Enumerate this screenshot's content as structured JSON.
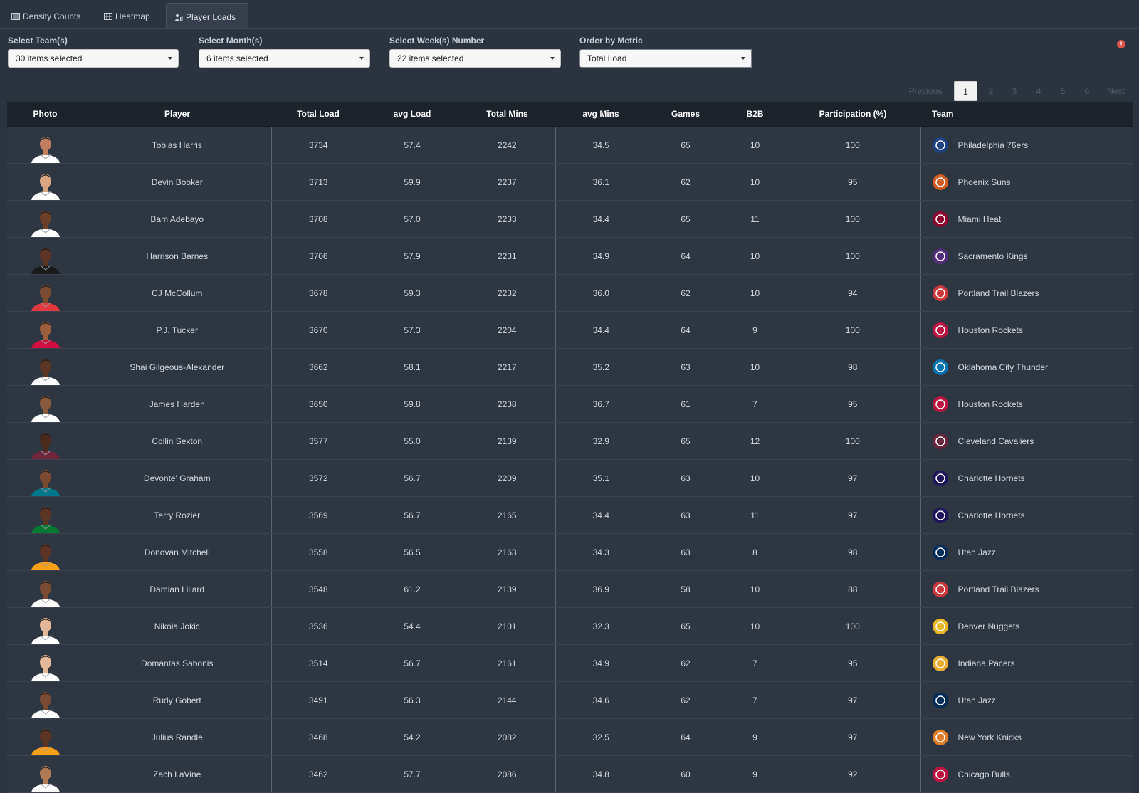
{
  "tabs": [
    {
      "label": "Density Counts",
      "icon": "list-icon"
    },
    {
      "label": "Heatmap",
      "icon": "grid-icon"
    },
    {
      "label": "Player Loads",
      "icon": "user-chart-icon",
      "active": true
    }
  ],
  "filters": {
    "teams": {
      "label": "Select Team(s)",
      "value": "30 items selected"
    },
    "months": {
      "label": "Select Month(s)",
      "value": "6 items selected"
    },
    "weeks": {
      "label": "Select Week(s) Number",
      "value": "22 items selected"
    },
    "metric": {
      "label": "Order by Metric",
      "value": "Total Load"
    }
  },
  "error_icon": {
    "glyph": "!",
    "color": "#d9534f"
  },
  "pagination": {
    "previous": "Previous",
    "next": "Next",
    "pages": [
      "1",
      "2",
      "3",
      "4",
      "5",
      "6"
    ],
    "current": "1"
  },
  "table": {
    "columns": [
      "Photo",
      "Player",
      "Total Load",
      "avg Load",
      "Total Mins",
      "avg Mins",
      "Games",
      "B2B",
      "Participation (%)",
      "Team"
    ],
    "rows": [
      {
        "player": "Tobias Harris",
        "total_load": "3734",
        "avg_load": "57.4",
        "total_mins": "2242",
        "avg_mins": "34.5",
        "games": "65",
        "b2b": "10",
        "participation": "100",
        "team": "Philadelphia 76ers",
        "skin": "#c08060",
        "jersey": "#ffffff",
        "logo_color": "#1d428a"
      },
      {
        "player": "Devin Booker",
        "total_load": "3713",
        "avg_load": "59.9",
        "total_mins": "2237",
        "avg_mins": "36.1",
        "games": "62",
        "b2b": "10",
        "participation": "95",
        "team": "Phoenix Suns",
        "skin": "#d9a583",
        "jersey": "#ffffff",
        "logo_color": "#e56020"
      },
      {
        "player": "Bam Adebayo",
        "total_load": "3708",
        "avg_load": "57.0",
        "total_mins": "2233",
        "avg_mins": "34.4",
        "games": "65",
        "b2b": "11",
        "participation": "100",
        "team": "Miami Heat",
        "skin": "#6b3f2a",
        "jersey": "#ffffff",
        "logo_color": "#98002e"
      },
      {
        "player": "Harrison Barnes",
        "total_load": "3706",
        "avg_load": "57.9",
        "total_mins": "2231",
        "avg_mins": "34.9",
        "games": "64",
        "b2b": "10",
        "participation": "100",
        "team": "Sacramento Kings",
        "skin": "#5a3424",
        "jersey": "#1a1a1a",
        "logo_color": "#5a2d81"
      },
      {
        "player": "CJ McCollum",
        "total_load": "3678",
        "avg_load": "59.3",
        "total_mins": "2232",
        "avg_mins": "36.0",
        "games": "62",
        "b2b": "10",
        "participation": "94",
        "team": "Portland Trail Blazers",
        "skin": "#7a4a33",
        "jersey": "#e03a3e",
        "logo_color": "#e03a3e"
      },
      {
        "player": "P.J. Tucker",
        "total_load": "3670",
        "avg_load": "57.3",
        "total_mins": "2204",
        "avg_mins": "34.4",
        "games": "64",
        "b2b": "9",
        "participation": "100",
        "team": "Houston Rockets",
        "skin": "#9a603e",
        "jersey": "#ce1141",
        "logo_color": "#ce1141"
      },
      {
        "player": "Shai Gilgeous-Alexander",
        "total_load": "3662",
        "avg_load": "58.1",
        "total_mins": "2217",
        "avg_mins": "35.2",
        "games": "63",
        "b2b": "10",
        "participation": "98",
        "team": "Oklahoma City Thunder",
        "skin": "#5a3424",
        "jersey": "#ffffff",
        "logo_color": "#007ac1"
      },
      {
        "player": "James Harden",
        "total_load": "3650",
        "avg_load": "59.8",
        "total_mins": "2238",
        "avg_mins": "36.7",
        "games": "61",
        "b2b": "7",
        "participation": "95",
        "team": "Houston Rockets",
        "skin": "#8a5a3c",
        "jersey": "#ffffff",
        "logo_color": "#ce1141"
      },
      {
        "player": "Collin Sexton",
        "total_load": "3577",
        "avg_load": "55.0",
        "total_mins": "2139",
        "avg_mins": "32.9",
        "games": "65",
        "b2b": "12",
        "participation": "100",
        "team": "Cleveland Cavaliers",
        "skin": "#4a2a1c",
        "jersey": "#6f263d",
        "logo_color": "#6f263d"
      },
      {
        "player": "Devonte' Graham",
        "total_load": "3572",
        "avg_load": "56.7",
        "total_mins": "2209",
        "avg_mins": "35.1",
        "games": "63",
        "b2b": "10",
        "participation": "97",
        "team": "Charlotte Hornets",
        "skin": "#7a4a33",
        "jersey": "#00788c",
        "logo_color": "#1d1160"
      },
      {
        "player": "Terry Rozier",
        "total_load": "3569",
        "avg_load": "56.7",
        "total_mins": "2165",
        "avg_mins": "34.4",
        "games": "63",
        "b2b": "11",
        "participation": "97",
        "team": "Charlotte Hornets",
        "skin": "#5a3424",
        "jersey": "#007a33",
        "logo_color": "#1d1160"
      },
      {
        "player": "Donovan Mitchell",
        "total_load": "3558",
        "avg_load": "56.5",
        "total_mins": "2163",
        "avg_mins": "34.3",
        "games": "63",
        "b2b": "8",
        "participation": "98",
        "team": "Utah Jazz",
        "skin": "#5a3424",
        "jersey": "#f9a01b",
        "logo_color": "#002b5c"
      },
      {
        "player": "Damian Lillard",
        "total_load": "3548",
        "avg_load": "61.2",
        "total_mins": "2139",
        "avg_mins": "36.9",
        "games": "58",
        "b2b": "10",
        "participation": "88",
        "team": "Portland Trail Blazers",
        "skin": "#7a4a33",
        "jersey": "#ffffff",
        "logo_color": "#e03a3e"
      },
      {
        "player": "Nikola Jokic",
        "total_load": "3536",
        "avg_load": "54.4",
        "total_mins": "2101",
        "avg_mins": "32.3",
        "games": "65",
        "b2b": "10",
        "participation": "100",
        "team": "Denver Nuggets",
        "skin": "#e6b89a",
        "jersey": "#ffffff",
        "logo_color": "#fec524"
      },
      {
        "player": "Domantas Sabonis",
        "total_load": "3514",
        "avg_load": "56.7",
        "total_mins": "2161",
        "avg_mins": "34.9",
        "games": "62",
        "b2b": "7",
        "participation": "95",
        "team": "Indiana Pacers",
        "skin": "#e6b89a",
        "jersey": "#ffffff",
        "logo_color": "#fdbb30"
      },
      {
        "player": "Rudy Gobert",
        "total_load": "3491",
        "avg_load": "56.3",
        "total_mins": "2144",
        "avg_mins": "34.6",
        "games": "62",
        "b2b": "7",
        "participation": "97",
        "team": "Utah Jazz",
        "skin": "#7a4a33",
        "jersey": "#ffffff",
        "logo_color": "#002b5c"
      },
      {
        "player": "Julius Randle",
        "total_load": "3468",
        "avg_load": "54.2",
        "total_mins": "2082",
        "avg_mins": "32.5",
        "games": "64",
        "b2b": "9",
        "participation": "97",
        "team": "New York Knicks",
        "skin": "#5a3424",
        "jersey": "#f9a01b",
        "logo_color": "#f58426"
      },
      {
        "player": "Zach LaVine",
        "total_load": "3462",
        "avg_load": "57.7",
        "total_mins": "2086",
        "avg_mins": "34.8",
        "games": "60",
        "b2b": "9",
        "participation": "92",
        "team": "Chicago Bulls",
        "skin": "#b07a55",
        "jersey": "#ffffff",
        "logo_color": "#ce1141"
      }
    ]
  }
}
